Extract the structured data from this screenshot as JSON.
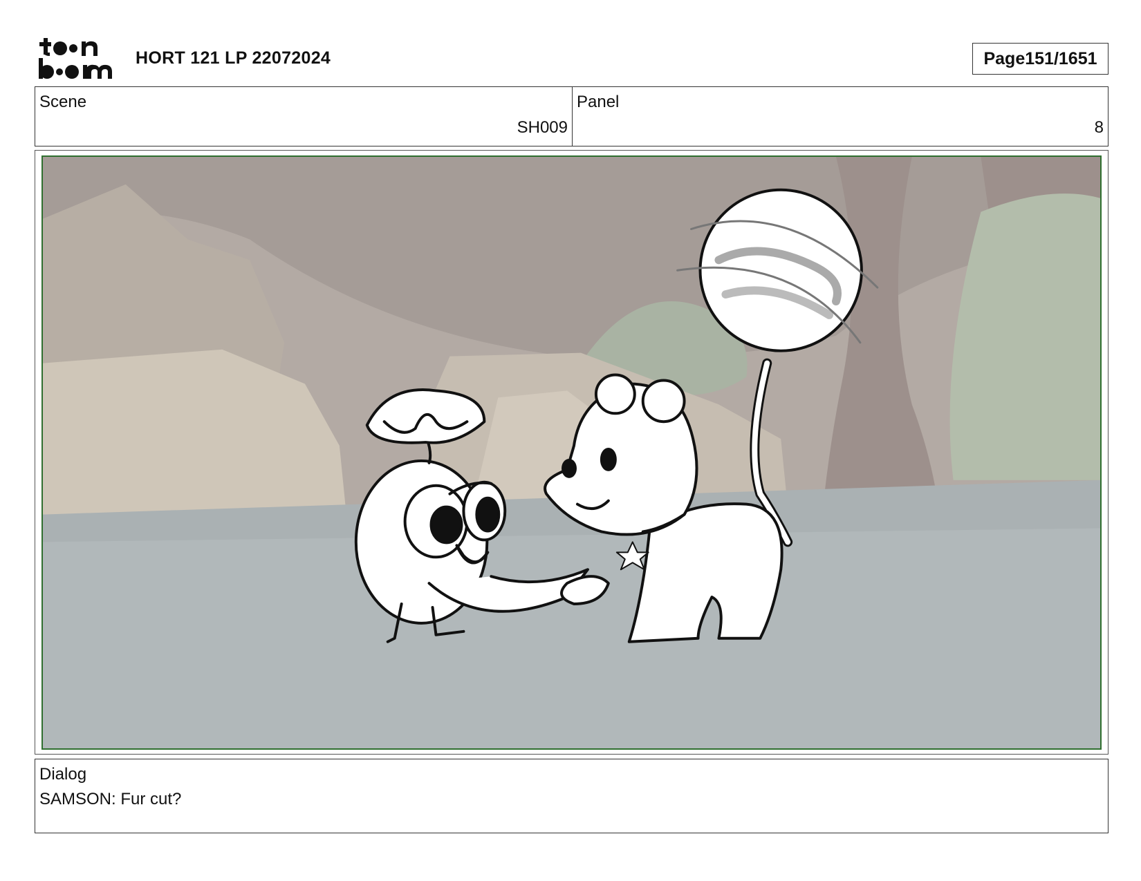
{
  "header": {
    "logo_text": "toon boom",
    "title": "HORT 121 LP 22072024",
    "page_label": "Page",
    "page_value": "151/1651"
  },
  "meta": {
    "scene_label": "Scene",
    "scene_value": "SH009",
    "panel_label": "Panel",
    "panel_value": "8"
  },
  "panel_image": {
    "description_icon": "storyboard-drawing",
    "frame_color": "#2f6f2f"
  },
  "dialog": {
    "label": "Dialog",
    "text": "SAMSON: Fur cut?"
  }
}
